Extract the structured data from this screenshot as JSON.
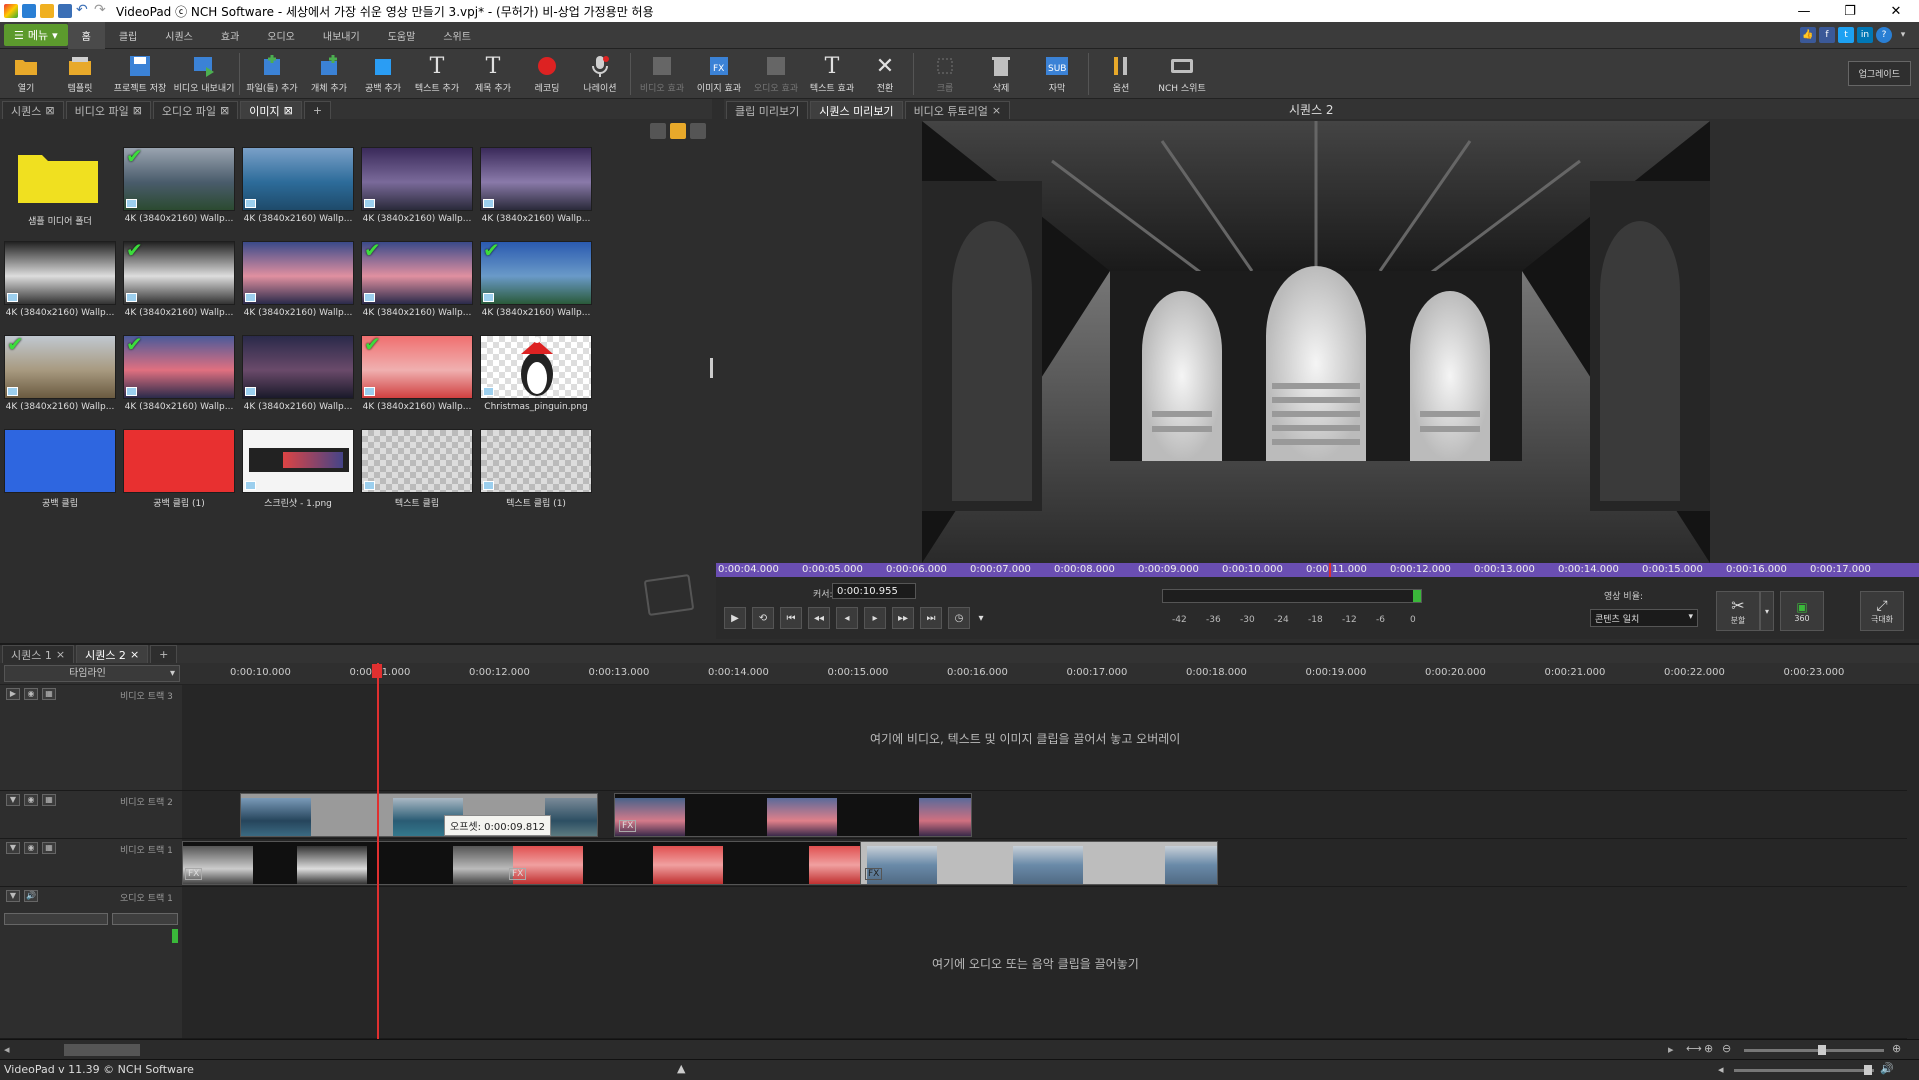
{
  "window": {
    "title": "VideoPad ⓒ NCH Software - 세상에서 가장 쉬운 영상 만들기 3.vpj* - (무허가) 비-상업 가정용만 허용"
  },
  "menu": {
    "menu_label": "메뉴",
    "tabs": [
      "홈",
      "클립",
      "시퀀스",
      "효과",
      "오디오",
      "내보내기",
      "도움말",
      "스위트"
    ]
  },
  "toolbar": {
    "items": [
      "열기",
      "템플릿",
      "프로젝트 저장",
      "비디오 내보내기",
      "파일(들) 추가",
      "개체 추가",
      "공백 추가",
      "텍스트 추가",
      "제목 추가",
      "레코딩",
      "나레이션",
      "비디오 효과",
      "이미지 효과",
      "오디오 효과",
      "텍스트 효과",
      "전환",
      "크롭",
      "삭제",
      "자막",
      "옵션",
      "NCH 스위트"
    ],
    "upgrade": "업그레이드"
  },
  "media_tabs": [
    "시퀀스",
    "비디오 파일",
    "오디오 파일",
    "이미지"
  ],
  "media_items": [
    {
      "caption": "샘플 미디어 폴더",
      "checked": false
    },
    {
      "caption": "4K (3840x2160) Wallp...",
      "checked": true
    },
    {
      "caption": "4K (3840x2160) Wallp...",
      "checked": false
    },
    {
      "caption": "4K (3840x2160) Wallp...",
      "checked": false
    },
    {
      "caption": "4K (3840x2160) Wallp...",
      "checked": false
    },
    {
      "caption": "4K (3840x2160) Wallp...",
      "checked": false
    },
    {
      "caption": "4K (3840x2160) Wallp...",
      "checked": true
    },
    {
      "caption": "4K (3840x2160) Wallp...",
      "checked": false
    },
    {
      "caption": "4K (3840x2160) Wallp...",
      "checked": true
    },
    {
      "caption": "4K (3840x2160) Wallp...",
      "checked": true
    },
    {
      "caption": "4K (3840x2160) Wallp...",
      "checked": true
    },
    {
      "caption": "4K (3840x2160) Wallp...",
      "checked": true
    },
    {
      "caption": "4K (3840x2160) Wallp...",
      "checked": false
    },
    {
      "caption": "4K (3840x2160) Wallp...",
      "checked": true
    },
    {
      "caption": "Christmas_pinguin.png",
      "checked": false
    },
    {
      "caption": "공백 클립",
      "checked": false
    },
    {
      "caption": "공백 클립 (1)",
      "checked": false
    },
    {
      "caption": "스크린샷 - 1.png",
      "checked": false
    },
    {
      "caption": "텍스트 클립",
      "checked": false
    },
    {
      "caption": "텍스트 클립 (1)",
      "checked": false
    }
  ],
  "preview": {
    "tabs": [
      "클립 미리보기",
      "시퀀스 미리보기",
      "비디오 튜토리얼"
    ],
    "sequence_title": "시퀀스 2",
    "ruler": [
      "0:00:04.000",
      "0:00:05.000",
      "0:00:06.000",
      "0:00:07.000",
      "0:00:08.000",
      "0:00:09.000",
      "0:00:10.000",
      "0:00:11.000",
      "0:00:12.000",
      "0:00:13.000",
      "0:00:14.000",
      "0:00:15.000",
      "0:00:16.000",
      "0:00:17.000"
    ],
    "cursor_label": "커서:",
    "cursor_value": "0:00:10.955",
    "meter_scale": [
      "-42",
      "-36",
      "-30",
      "-24",
      "-18",
      "-12",
      "-6",
      "0"
    ],
    "aspect_label": "영상 비율:",
    "aspect_value": "콘텐츠 일치",
    "split": "분할",
    "view360": "360",
    "fullscreen": "극대화"
  },
  "timeline": {
    "tabs": [
      "시퀀스 1",
      "시퀀스 2"
    ],
    "mode": "타임라인",
    "ticks": [
      "0:00:10.000",
      "0:00:11.000",
      "0:00:12.000",
      "0:00:13.000",
      "0:00:14.000",
      "0:00:15.000",
      "0:00:16.000",
      "0:00:17.000",
      "0:00:18.000",
      "0:00:19.000",
      "0:00:20.000",
      "0:00:21.000",
      "0:00:22.000",
      "0:00:23.000"
    ],
    "tracks": {
      "video3": "비디오 트랙 3",
      "video2": "비디오 트랙 2",
      "video1": "비디오 트랙 1",
      "audio1": "오디오 트랙 1"
    },
    "overlay_hint": "여기에 비디오, 텍스트 및 이미지 클립을 끌어서 놓고 오버레이",
    "audio_hint": "여기에 오디오 또는 음악 클립을 끌어놓기",
    "tooltip": "오프셋: 0:00:09.812"
  },
  "status": {
    "text": "VideoPad v 11.39 © NCH Software"
  },
  "colors": {
    "accent": "#5c9a2d",
    "ruler": "#6a4eb2",
    "playhead": "#e03030"
  }
}
